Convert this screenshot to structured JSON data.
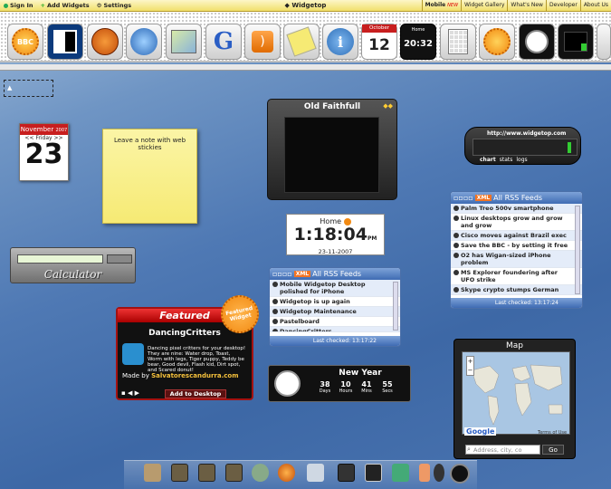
{
  "topbar": {
    "sign_in": "Sign In",
    "add_widgets": "Add Widgets",
    "settings": "Settings",
    "title": "Widgetop",
    "right_links": [
      "Mobile",
      "Widget Gallery",
      "What's New",
      "Developer",
      "About Us"
    ],
    "mobile_badge": "NEW"
  },
  "toolbar": {
    "icons": [
      {
        "name": "bbc-icon",
        "text": "BBC"
      },
      {
        "name": "logo-icon",
        "text": ""
      },
      {
        "name": "basketball-icon",
        "text": ""
      },
      {
        "name": "globe-search-icon",
        "text": ""
      },
      {
        "name": "map-icon",
        "text": ""
      },
      {
        "name": "google-icon",
        "text": "G"
      },
      {
        "name": "rss-icon",
        "text": ""
      },
      {
        "name": "notepad-icon",
        "text": ""
      },
      {
        "name": "info-icon",
        "text": "i"
      },
      {
        "name": "calendar-icon",
        "text": "12",
        "month": "October"
      },
      {
        "name": "clock-digital-icon",
        "text": "20:32",
        "label": "Home"
      },
      {
        "name": "calculator-icon",
        "text": ""
      },
      {
        "name": "widget-gallery-icon",
        "text": ""
      },
      {
        "name": "analog-clock-icon",
        "text": ""
      },
      {
        "name": "monitor-icon",
        "text": ""
      }
    ]
  },
  "calendar": {
    "month": "November",
    "year": "2007",
    "dow": "Friday",
    "day": "23"
  },
  "sticky": {
    "text": "Leave a note with web stickies"
  },
  "calculator": {
    "label": "Calculator"
  },
  "featured": {
    "header": "Featured",
    "badge": "Featured Widget",
    "name": "DancingCritters",
    "description": "Dancing pixel critters for your desktop! They are nine: Water drop, Toast, Worm with legs, Tiger puppy, Teddy be bear, Good devil, Flash kid, Dirt spot, and Scared donut!",
    "made_by_label": "Made by",
    "author": "Salvatorescandurra.com",
    "add_button": "Add to Desktop"
  },
  "old_faithful": {
    "title": "Old Faithfull"
  },
  "clock": {
    "location": "Home",
    "time": "1:18:04",
    "ampm": "PM",
    "date": "23-11-2007"
  },
  "rss_center": {
    "title": "All RSS Feeds",
    "xml": "XML",
    "items": [
      "Mobile Widgetop Desktop polished for iPhone",
      "Widgetop is up again",
      "Widgetop Maintenance",
      "Pastelboard",
      "DancingCritters"
    ],
    "last_checked": "Last checked: 13:17:22"
  },
  "rss_right": {
    "title": "All RSS Feeds",
    "xml": "XML",
    "items": [
      "Palm Treo 500v smartphone",
      "Linux desktops grow and grow and grow",
      "Cisco moves against Brazil exec",
      "Save the BBC - by setting it free",
      "O2 has Wigan-sized iPhone problem",
      "MS Explorer foundering after UFO strike",
      "Skype crypto stumps German"
    ],
    "last_checked": "Last checked: 13:17:24"
  },
  "new_year": {
    "title": "New Year",
    "values": [
      "38",
      "10",
      "41",
      "55"
    ],
    "units": [
      "Days",
      "Hours",
      "Mins",
      "Secs"
    ]
  },
  "stats": {
    "url": "http://www.widgetop.com",
    "tabs": [
      "chart",
      "stats",
      "logs"
    ]
  },
  "map": {
    "title": "Map",
    "placeholder": "Address, city, co",
    "go": "Go",
    "brand": "Google",
    "terms": "Terms of Use"
  },
  "colors": {
    "accent": "#c81e1e",
    "rss": "#3f6cb3",
    "sticky": "#f6ea74"
  }
}
